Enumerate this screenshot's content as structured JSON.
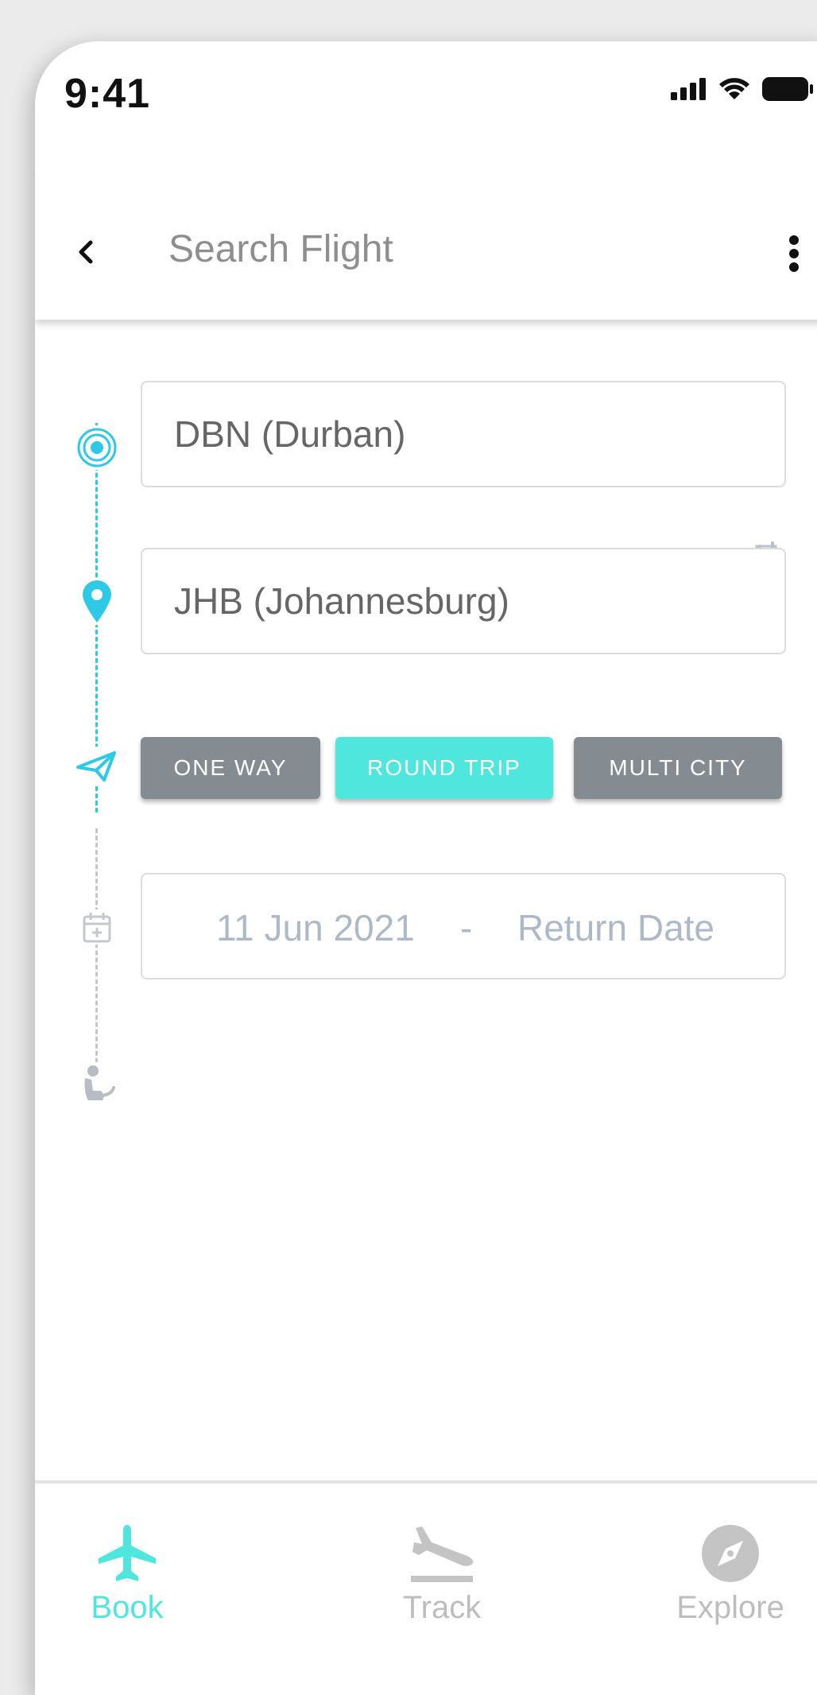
{
  "status_bar": {
    "time": "9:41",
    "icons": [
      "signal-icon",
      "wifi-icon",
      "battery-icon"
    ]
  },
  "app_bar": {
    "title": "Search Flight",
    "back_icon": "chevron-left-icon",
    "more_icon": "more-vertical-icon"
  },
  "search": {
    "origin_value": "DBN (Durban)",
    "destination_value": "JHB (Johannesburg)",
    "swap_icon": "swap-icon"
  },
  "trip_types": [
    {
      "label": "ONE WAY",
      "selected": false
    },
    {
      "label": "ROUND TRIP",
      "selected": true
    },
    {
      "label": "MULTI CITY",
      "selected": false
    }
  ],
  "dates": {
    "depart": "11 Jun 2021",
    "separator": "-",
    "return_placeholder": "Return Date"
  },
  "timeline_icons": [
    "origin-target-icon",
    "destination-pin-icon",
    "paper-plane-icon",
    "calendar-add-icon",
    "passenger-icon"
  ],
  "bottom_nav": [
    {
      "label": "Book",
      "icon": "airplane-icon",
      "active": true
    },
    {
      "label": "Track",
      "icon": "flight-departure-icon",
      "active": false
    },
    {
      "label": "Explore",
      "icon": "compass-icon",
      "active": false
    }
  ],
  "colors": {
    "accent": "#4fe7dd",
    "timeline_blue": "#2ec9e6",
    "inactive_button": "#848c91",
    "title_grey": "#8e8e8e",
    "placeholder": "#aeb9c7"
  }
}
